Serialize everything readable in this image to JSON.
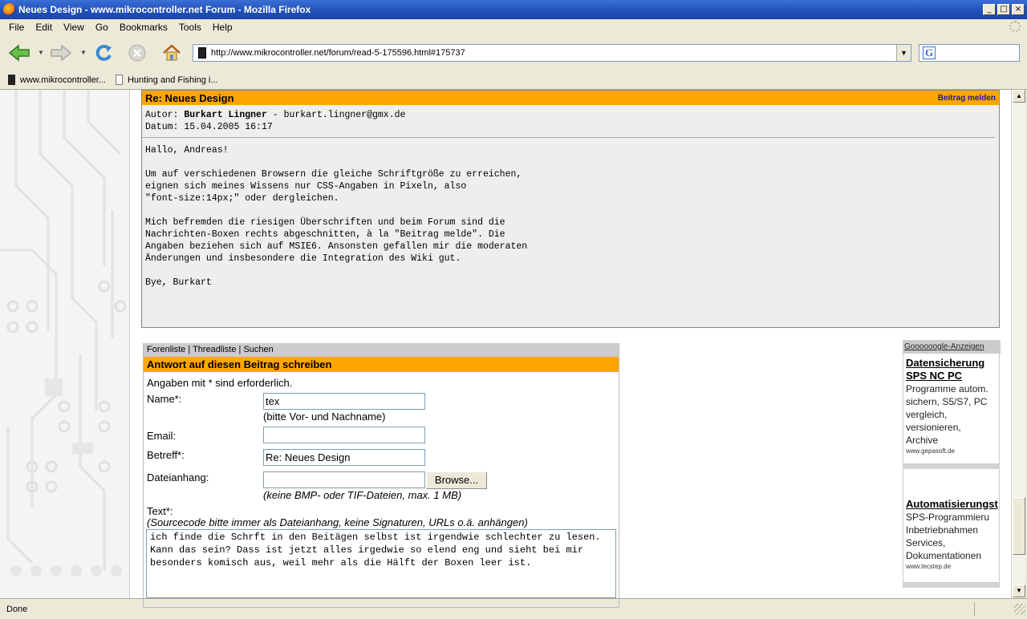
{
  "window": {
    "title": "Neues Design - www.mikrocontroller.net Forum - Mozilla Firefox",
    "min_glyph": "_",
    "max_glyph": "□",
    "close_glyph": "×"
  },
  "menu": [
    "File",
    "Edit",
    "View",
    "Go",
    "Bookmarks",
    "Tools",
    "Help"
  ],
  "nav": {
    "url": "http://www.mikrocontroller.net/forum/read-5-175596.html#175737",
    "back_icon": "back-arrow-icon",
    "forward_icon": "forward-arrow-icon",
    "reload_icon": "reload-icon",
    "stop_icon": "stop-icon",
    "home_icon": "home-icon",
    "search_engine_glyph": "G"
  },
  "bookmarks": [
    "www.mikrocontroller...",
    "Hunting and Fishing i..."
  ],
  "post": {
    "subject": "Re: Neues Design",
    "report_link": "Beitrag melden",
    "author_label": "Autor:",
    "author_name": "Burkart Lingner",
    "author_email": "- burkart.lingner@gmx.de",
    "date_label": "Datum:",
    "date_value": "15.04.2005 16:17",
    "body": "Hallo, Andreas!\n\nUm auf verschiedenen Browsern die gleiche Schriftgröße zu erreichen,\neignen sich meines Wissens nur CSS-Angaben in Pixeln, also\n\"font-size:14px;\" oder dergleichen.\n\nMich befremden die riesigen Überschriften und beim Forum sind die\nNachrichten-Boxen rechts abgeschnitten, à la \"Beitrag melde\". Die\nAngaben beziehen sich auf MSIE6. Ansonsten gefallen mir die moderaten\nÄnderungen und insbesondere die Integration des Wiki gut.\n\nBye, Burkart"
  },
  "reply": {
    "crumbs": "Forenliste | Threadliste | Suchen",
    "title": "Antwort auf diesen Beitrag schreiben",
    "required_note": "Angaben mit * sind erforderlich.",
    "name_label": "Name*:",
    "name_value": "tex",
    "name_hint": "(bitte Vor- und Nachname)",
    "email_label": "Email:",
    "email_value": "",
    "subject_label": "Betreff*:",
    "subject_value": "Re: Neues Design",
    "attach_label": "Dateianhang:",
    "attach_value": "",
    "browse_label": "Browse...",
    "attach_hint": "(keine BMP- oder TIF-Dateien, max. 1 MB)",
    "text_label": "Text*:",
    "text_hint": "(Sourcecode bitte immer als Dateianhang, keine Signaturen, URLs o.ä. anhängen)",
    "text_value": "ich finde die Schrft in den Beitägen selbst ist irgendwie schlechter zu lesen. Kann das sein? Dass ist jetzt alles irgedwie so elend eng und sieht bei mir besonders komisch aus, weil mehr als die Hälft der Boxen leer ist."
  },
  "ads": {
    "header": "Goooooogle-Anzeigen",
    "items": [
      {
        "title": "Datensicherung\nSPS NC PC",
        "text": "Programme autom.\nsichern, S5/S7, PC\nvergleich,\nversionieren,\nArchive",
        "url": "www.gepasoft.de"
      },
      {
        "title": "Automatisierungst",
        "text": "SPS-Programmieru\nInbetriebnahmen\nServices,\nDokumentationen",
        "url": "www.tecstep.de"
      }
    ]
  },
  "status": {
    "text": "Done"
  },
  "colors": {
    "accent_orange": "#ffa500",
    "titlebar_blue": "#1f4fb8",
    "report_link": "#1a1aa6"
  }
}
